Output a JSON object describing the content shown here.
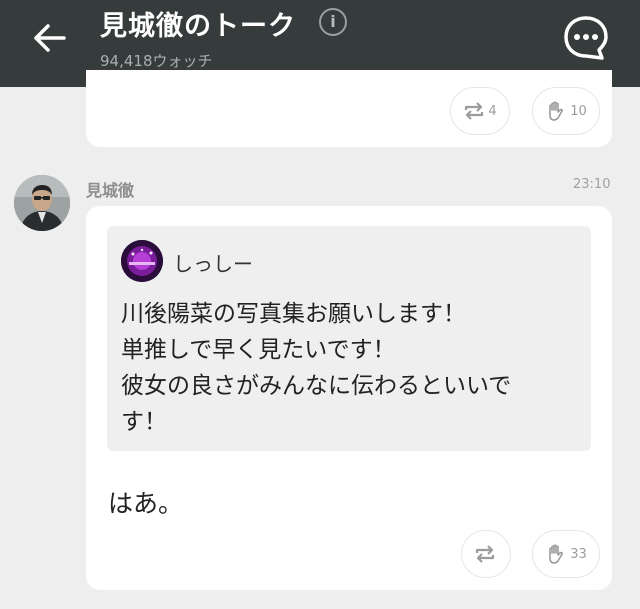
{
  "header": {
    "title": "見城徹のトーク",
    "info_icon": "i",
    "watch_count": "94,418ウォッチ"
  },
  "prev_post": {
    "repost_count": "4",
    "clap_count": "10"
  },
  "post": {
    "sender": "見城徹",
    "time": "23:10",
    "quote": {
      "name": "しっしー",
      "lines": [
        "川後陽菜の写真集お願いします！",
        "単推しで早く見たいです！",
        "彼女の良さがみんなに伝わるといいで",
        "す！"
      ]
    },
    "reply": "はあ。",
    "repost_count": "",
    "clap_count": "33"
  },
  "colors": {
    "header_bg": "#363b3b",
    "page_bg": "#eeeeee",
    "card_bg": "#ffffff",
    "quote_bg": "#efefef"
  },
  "icons": [
    "back-arrow-icon",
    "info-icon",
    "chat-bubble-icon",
    "repost-icon",
    "clap-hand-icon"
  ]
}
